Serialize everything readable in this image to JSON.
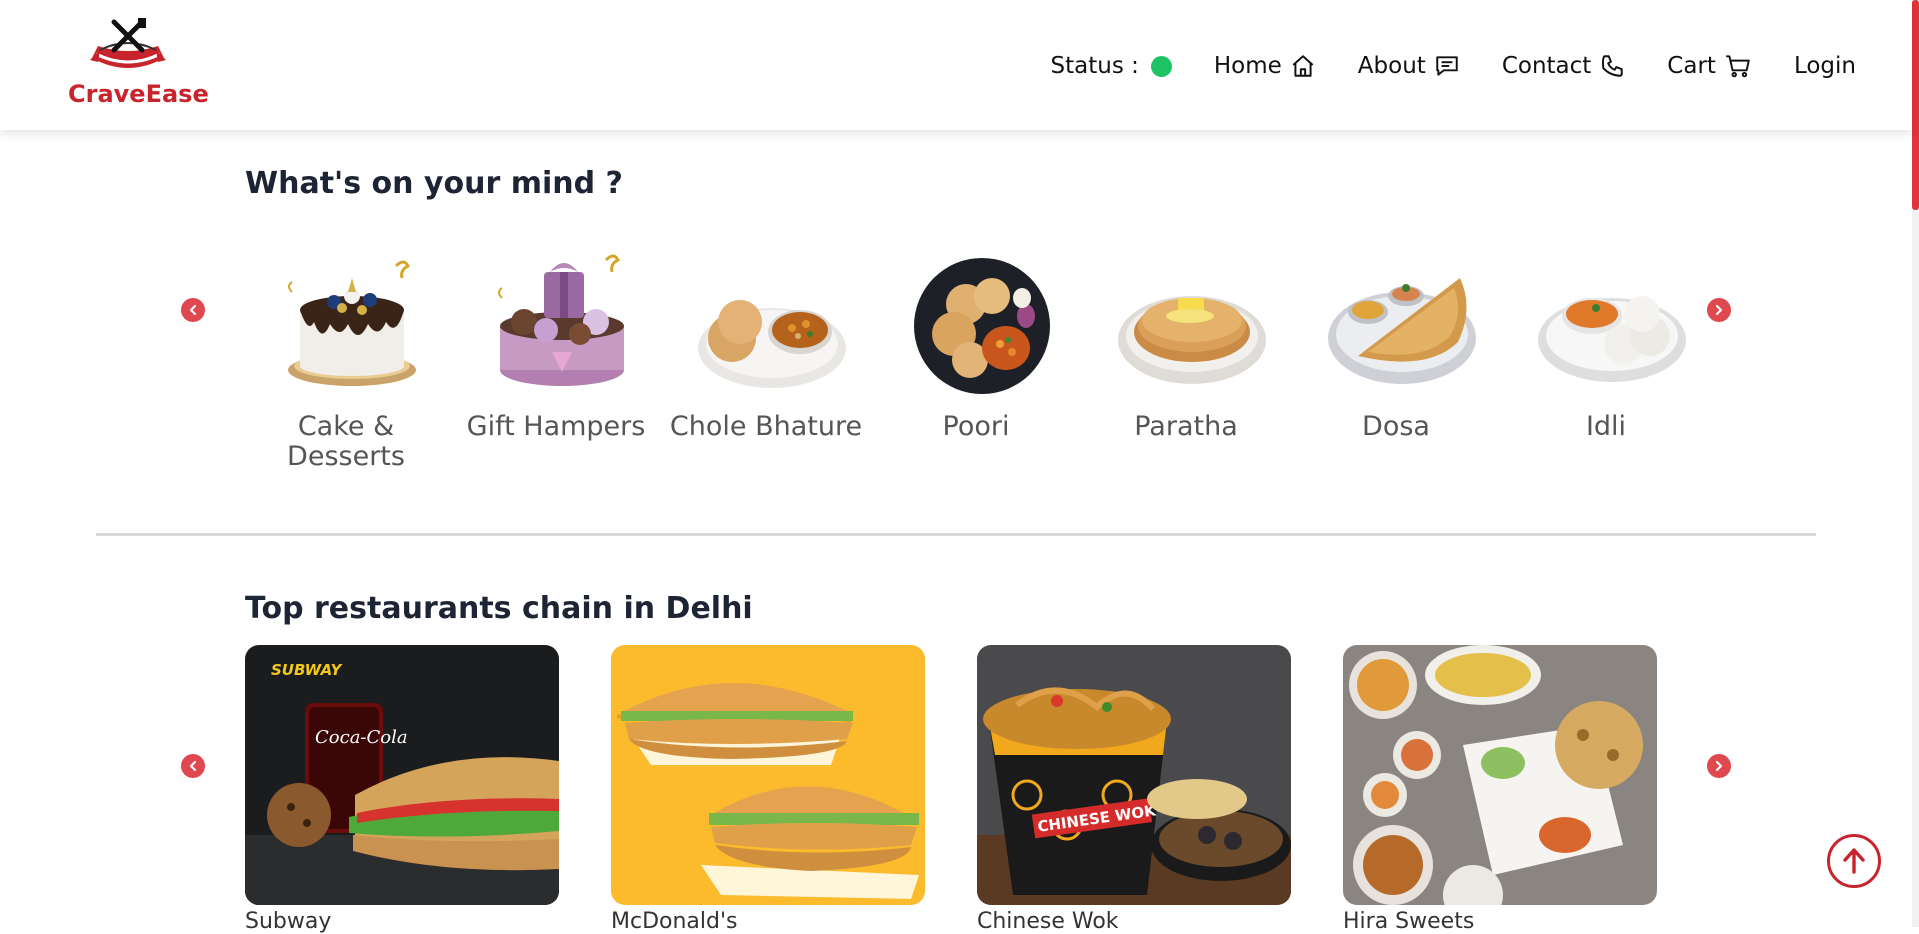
{
  "brand": {
    "name": "CraveEase",
    "color": "#c8242b"
  },
  "nav": {
    "status_label": "Status :",
    "status_color": "#1ec463",
    "home": "Home",
    "about": "About",
    "contact": "Contact",
    "cart": "Cart",
    "login": "Login"
  },
  "mind": {
    "title": "What's on your mind ?",
    "items": [
      {
        "label": "Cake & Desserts",
        "icon": "cake-image"
      },
      {
        "label": "Gift Hampers",
        "icon": "gift-hamper-image"
      },
      {
        "label": "Chole Bhature",
        "icon": "chole-bhature-image"
      },
      {
        "label": "Poori",
        "icon": "poori-image"
      },
      {
        "label": "Paratha",
        "icon": "paratha-image"
      },
      {
        "label": "Dosa",
        "icon": "dosa-image"
      },
      {
        "label": "Idli",
        "icon": "idli-image"
      }
    ]
  },
  "restaurants": {
    "title": "Top restaurants chain in Delhi",
    "items": [
      {
        "name": "Subway",
        "logo_text": "SUBWAY",
        "drink_text": "Coca-Cola"
      },
      {
        "name": "McDonald's"
      },
      {
        "name": "Chinese Wok",
        "bucket_text": "CHINESE WOK"
      },
      {
        "name": "Hira Sweets"
      }
    ]
  },
  "colors": {
    "accent": "#e0484f",
    "scroll_thumb": "#e0353a"
  }
}
